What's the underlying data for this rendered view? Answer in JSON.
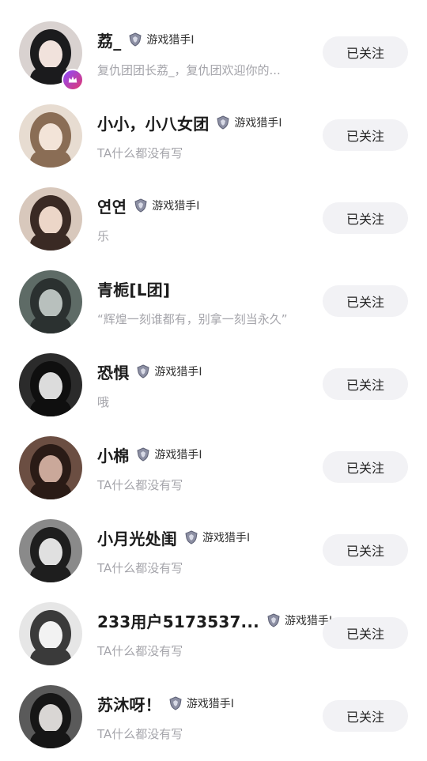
{
  "follow_list": [
    {
      "name": "荔_",
      "badge": "游戏猎手Ⅰ",
      "bio": "复仇团团长荔_，复仇团欢迎你的...",
      "button": "已关注",
      "vip": true,
      "avatar_bg": "#d9d2d0",
      "avatar_hair": "#1b1b1d",
      "avatar_face": "#f1e2dc"
    },
    {
      "name": "小小，小八女团",
      "badge": "游戏猎手Ⅰ",
      "bio": "TA什么都没有写",
      "button": "已关注",
      "vip": false,
      "avatar_bg": "#e7dcd1",
      "avatar_hair": "#8a6d55",
      "avatar_face": "#f3e4d8"
    },
    {
      "name": "연연",
      "badge": "游戏猎手Ⅰ",
      "bio": "乐",
      "button": "已关注",
      "vip": false,
      "avatar_bg": "#d8c8bc",
      "avatar_hair": "#3a2a24",
      "avatar_face": "#ecd6c8"
    },
    {
      "name": "青栀[L团]",
      "badge": "",
      "bio": "“辉煌一刻谁都有，别拿一刻当永久”",
      "button": "已关注",
      "vip": false,
      "avatar_bg": "#5e6b66",
      "avatar_hair": "#2b3130",
      "avatar_face": "#b8c0bd"
    },
    {
      "name": "恐惧",
      "badge": "游戏猎手Ⅰ",
      "bio": "哦",
      "button": "已关注",
      "vip": false,
      "avatar_bg": "#2b2b2b",
      "avatar_hair": "#0f0f0f",
      "avatar_face": "#dcdcdc"
    },
    {
      "name": "小棉",
      "badge": "游戏猎手Ⅰ",
      "bio": "TA什么都没有写",
      "button": "已关注",
      "vip": false,
      "avatar_bg": "#6b4e42",
      "avatar_hair": "#2a1b16",
      "avatar_face": "#caa89a"
    },
    {
      "name": "小月光处闺",
      "badge": "游戏猎手Ⅰ",
      "bio": "TA什么都没有写",
      "button": "已关注",
      "vip": false,
      "avatar_bg": "#8a8a8a",
      "avatar_hair": "#1e1e1e",
      "avatar_face": "#e0e0e0"
    },
    {
      "name": "233用户5173537...",
      "badge": "游戏猎手Ⅰ",
      "bio": "TA什么都没有写",
      "button": "已关注",
      "vip": false,
      "avatar_bg": "#e6e6e6",
      "avatar_hair": "#3a3a3a",
      "avatar_face": "#f2f2f2"
    },
    {
      "name": "苏沐呀！",
      "badge": "游戏猎手Ⅰ",
      "bio": "TA什么都没有写",
      "button": "已关注",
      "vip": false,
      "avatar_bg": "#5a5a5a",
      "avatar_hair": "#161616",
      "avatar_face": "#d9d6d4"
    }
  ],
  "colors": {
    "button_bg": "#f2f2f5",
    "bio_gray": "#a4a4aa",
    "name_text": "#1c1c1c"
  },
  "icons": {
    "badge_icon": "game-hunter-shield-icon",
    "vip_icon": "crown-icon"
  }
}
